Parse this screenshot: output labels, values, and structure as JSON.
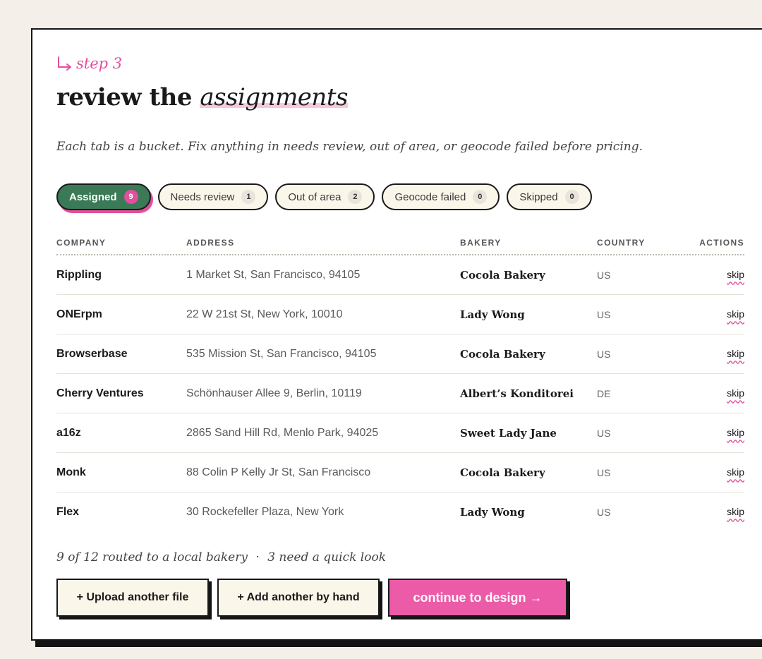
{
  "step_label": "step 3",
  "title": {
    "main": "review the",
    "emphasis": "assignments"
  },
  "subtitle": "Each tab is a bucket. Fix anything in needs review, out of area, or geocode failed before pricing.",
  "tabs": [
    {
      "label": "Assigned",
      "count": "9"
    },
    {
      "label": "Needs review",
      "count": "1"
    },
    {
      "label": "Out of area",
      "count": "2"
    },
    {
      "label": "Geocode failed",
      "count": "0"
    },
    {
      "label": "Skipped",
      "count": "0"
    }
  ],
  "columns": {
    "company": "COMPANY",
    "address": "ADDRESS",
    "bakery": "BAKERY",
    "country": "COUNTRY",
    "actions": "ACTIONS"
  },
  "rows": [
    {
      "company": "Rippling",
      "address": "1 Market St, San Francisco, 94105",
      "bakery": "Cocola Bakery",
      "country": "US",
      "action": "skip"
    },
    {
      "company": "ONErpm",
      "address": "22 W 21st St, New York, 10010",
      "bakery": "Lady Wong",
      "country": "US",
      "action": "skip"
    },
    {
      "company": "Browserbase",
      "address": "535 Mission St, San Francisco, 94105",
      "bakery": "Cocola Bakery",
      "country": "US",
      "action": "skip"
    },
    {
      "company": "Cherry Ventures",
      "address": "Schönhauser Allee 9, Berlin, 10119",
      "bakery": "Albert’s Konditorei",
      "country": "DE",
      "action": "skip"
    },
    {
      "company": "a16z",
      "address": "2865 Sand Hill Rd, Menlo Park, 94025",
      "bakery": "Sweet Lady Jane",
      "country": "US",
      "action": "skip"
    },
    {
      "company": "Monk",
      "address": "88 Colin P Kelly Jr St, San Francisco",
      "bakery": "Cocola Bakery",
      "country": "US",
      "action": "skip"
    },
    {
      "company": "Flex",
      "address": "30 Rockefeller Plaza, New York",
      "bakery": "Lady Wong",
      "country": "US",
      "action": "skip"
    }
  ],
  "summary": {
    "routed": "9 of 12 routed to a local bakery",
    "separator": "·",
    "review": "3 need a quick look"
  },
  "buttons": {
    "upload": "+ Upload another file",
    "add": "+ Add another by hand",
    "continue": "continue to design →"
  },
  "colors": {
    "accent_pink": "#e24f9c",
    "active_green": "#3a7a56",
    "cream": "#fbf6ea",
    "background": "#f4efe8"
  },
  "icons": {
    "step": "arrow-down-right-icon"
  }
}
